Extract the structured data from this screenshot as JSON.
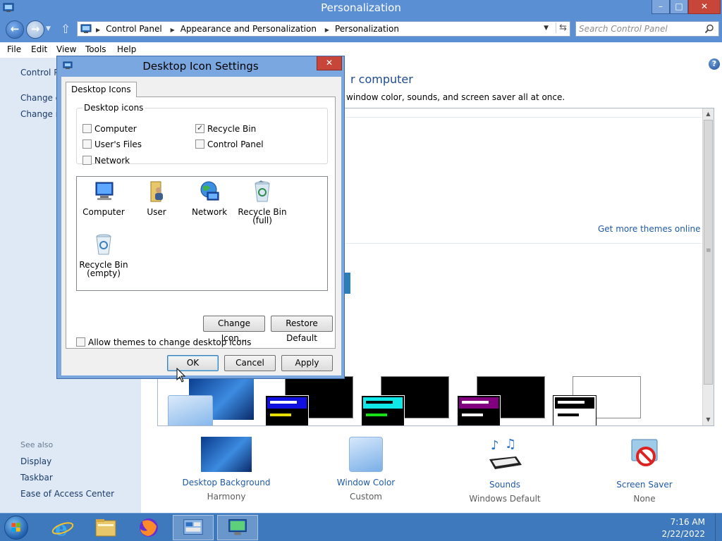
{
  "window": {
    "title": "Personalization",
    "minimize_glyph": "–",
    "maximize_glyph": "□",
    "close_glyph": "✕"
  },
  "address": {
    "crumbs": [
      "Control Panel",
      "Appearance and Personalization",
      "Personalization"
    ],
    "search_placeholder": "Search Control Panel"
  },
  "menu": [
    "File",
    "Edit",
    "View",
    "Tools",
    "Help"
  ],
  "left_pane": {
    "links": [
      "Control P",
      "Change d",
      "Change m"
    ],
    "see_also": "See also",
    "see_also_links": [
      "Display",
      "Taskbar",
      "Ease of Access Center"
    ]
  },
  "content": {
    "title": "r computer",
    "description": "window color, sounds, and screen saver all at once.",
    "get_more_themes": "Get more themes online"
  },
  "personalize_items": [
    {
      "label": "Desktop Background",
      "sub": "Harmony"
    },
    {
      "label": "Window Color",
      "sub": "Custom"
    },
    {
      "label": "Sounds",
      "sub": "Windows Default"
    },
    {
      "label": "Screen Saver",
      "sub": "None"
    }
  ],
  "dialog": {
    "title": "Desktop Icon Settings",
    "close_glyph": "✕",
    "tab": "Desktop Icons",
    "group_label": "Desktop icons",
    "checkboxes": [
      {
        "label": "Computer",
        "checked": false
      },
      {
        "label": "Recycle Bin",
        "checked": true
      },
      {
        "label": "User's Files",
        "checked": false
      },
      {
        "label": "Control Panel",
        "checked": false
      },
      {
        "label": "Network",
        "checked": false
      }
    ],
    "icons": [
      {
        "line1": "Computer",
        "line2": ""
      },
      {
        "line1": "User",
        "line2": ""
      },
      {
        "line1": "Network",
        "line2": ""
      },
      {
        "line1": "Recycle Bin",
        "line2": "(full)"
      },
      {
        "line1": "Recycle Bin",
        "line2": "(empty)"
      }
    ],
    "change_icon": "Change Icon...",
    "restore_default": "Restore Default",
    "allow_themes": "Allow themes to change desktop icons",
    "allow_themes_checked": false,
    "ok": "OK",
    "cancel": "Cancel",
    "apply": "Apply"
  },
  "taskbar": {
    "time": "7:16 AM",
    "date": "2/22/2022"
  },
  "colors": {
    "title_bar": "#5a8fd4",
    "taskbar": "#3f79bd",
    "link": "#1e5aa8",
    "close_red": "#c7463a"
  }
}
